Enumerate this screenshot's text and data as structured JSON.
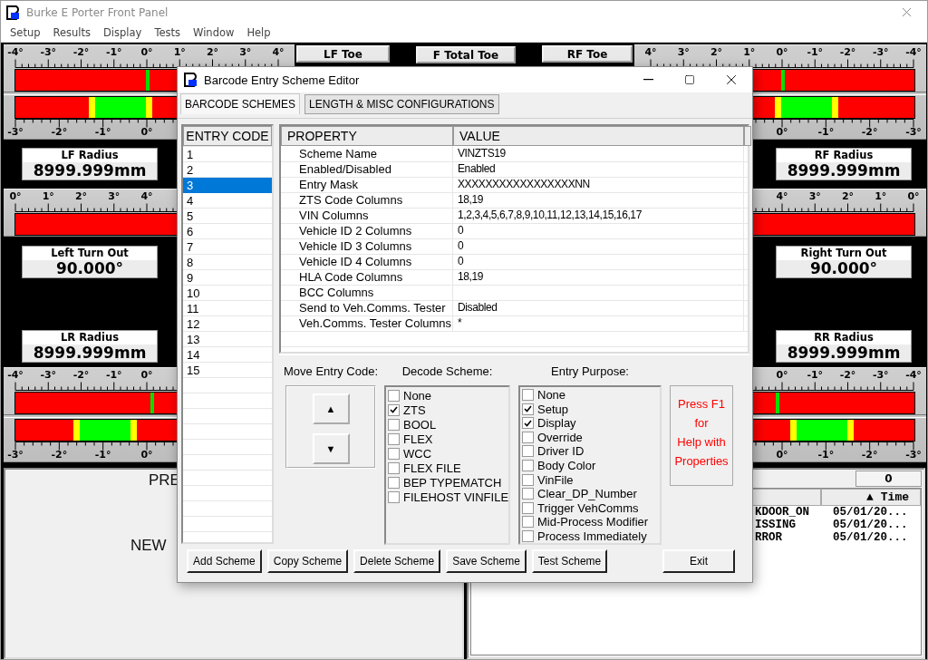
{
  "main_window": {
    "title": "Burke E Porter Front Panel"
  },
  "menu": [
    "Setup",
    "Results",
    "Display",
    "Tests",
    "Window",
    "Help"
  ],
  "front_gauges": {
    "left": {
      "label": "LF Toe",
      "top_scale": [
        "-4°",
        "-3°",
        "-2°",
        "-1°",
        "0°",
        "1°",
        "2°",
        "3°",
        "4°"
      ],
      "bars": [
        {
          "kind": "marker",
          "level": 0.5
        },
        {
          "kind": "band",
          "level": 0.4
        }
      ],
      "bottom_scale": [
        "-3°",
        "-2°",
        "-1°",
        "0°"
      ]
    },
    "center_label": "F Total Toe",
    "right": {
      "label": "RF Toe",
      "top_scale": [
        "4°",
        "3°",
        "2°",
        "1°",
        "0°",
        "-1°",
        "-2°",
        "-3°",
        "-4°"
      ],
      "bars": [
        {
          "kind": "marker",
          "level": 0.5
        },
        {
          "kind": "band",
          "level": 0.59
        }
      ],
      "bottom_scale": [
        "0°",
        "-1°",
        "-2°",
        "-3°"
      ]
    }
  },
  "radius_boxes": {
    "left": [
      {
        "label": "LF Radius",
        "value": "8999.999mm"
      }
    ],
    "right": [
      {
        "label": "RF Radius",
        "value": "8999.999mm"
      }
    ]
  },
  "mid_gauges": {
    "left": {
      "top_scale": [
        "0°",
        "1°",
        "2°",
        "3°",
        "4°"
      ],
      "bars": [
        {
          "kind": "plain"
        }
      ]
    },
    "right": {
      "top_scale": [
        "4°",
        "3°",
        "2°",
        "1°",
        "0°"
      ],
      "bars": [
        {
          "kind": "plain"
        }
      ]
    }
  },
  "turn_boxes": {
    "left": [
      {
        "label": "Left Turn Out",
        "value": "90.000°"
      },
      {
        "label": "LR Radius",
        "value": "8999.999mm"
      }
    ],
    "right": [
      {
        "label": "Right Turn Out",
        "value": "90.000°"
      },
      {
        "label": "RR Radius",
        "value": "8999.999mm"
      }
    ]
  },
  "rear_gauges": {
    "left": {
      "top_scale": [
        "-4°",
        "-3°",
        "-2°",
        "-1°",
        "0°"
      ],
      "bars": [
        {
          "kind": "marker",
          "level": 0.52
        },
        {
          "kind": "band",
          "level": 0.34
        }
      ],
      "bottom_scale": [
        "-3°",
        "-2°",
        "-1°",
        "0°"
      ]
    },
    "right": {
      "top_scale": [
        "0°",
        "-1°",
        "-2°",
        "-3°",
        "-4°"
      ],
      "bars": [
        {
          "kind": "marker",
          "level": 0.48
        },
        {
          "kind": "band",
          "level": 0.65
        }
      ],
      "bottom_scale": [
        "0°",
        "-1°",
        "-2°",
        "-3°"
      ]
    }
  },
  "prompt_panel": {
    "lines": [
      "PRE",
      "NEW"
    ]
  },
  "event_panel": {
    "counter": "0",
    "sort_glyph": "▲",
    "time_column": "Time",
    "rows": [
      {
        "event": "KDOOR_ON",
        "time": "05/01/20..."
      },
      {
        "event": "ISSING",
        "time": "05/01/20..."
      },
      {
        "event": "RROR",
        "time": "05/01/20..."
      }
    ]
  },
  "dialog": {
    "title": "Barcode Entry Scheme Editor",
    "tabs": [
      {
        "label": "BARCODE SCHEMES",
        "selected": true
      },
      {
        "label": "LENGTH & MISC CONFIGURATIONS",
        "selected": false
      }
    ],
    "entry_code_header": "ENTRY CODE",
    "entry_codes": [
      {
        "label": "1",
        "selected": false
      },
      {
        "label": "2",
        "selected": false
      },
      {
        "label": "3",
        "selected": true
      },
      {
        "label": "4",
        "selected": false
      },
      {
        "label": "5",
        "selected": false
      },
      {
        "label": "6",
        "selected": false
      },
      {
        "label": "7",
        "selected": false
      },
      {
        "label": "8",
        "selected": false
      },
      {
        "label": "9",
        "selected": false
      },
      {
        "label": "10",
        "selected": false
      },
      {
        "label": "11",
        "selected": false
      },
      {
        "label": "12",
        "selected": false
      },
      {
        "label": "13",
        "selected": false
      },
      {
        "label": "14",
        "selected": false
      },
      {
        "label": "15",
        "selected": false
      }
    ],
    "property_columns": [
      "PROPERTY",
      "VALUE"
    ],
    "properties": [
      {
        "name": "Scheme Name",
        "value": "VINZTS19"
      },
      {
        "name": "Enabled/Disabled",
        "value": "Enabled"
      },
      {
        "name": "Entry Mask",
        "value": "XXXXXXXXXXXXXXXXXNN"
      },
      {
        "name": "ZTS Code Columns",
        "value": "18,19"
      },
      {
        "name": "VIN Columns",
        "value": "1,2,3,4,5,6,7,8,9,10,11,12,13,14,15,16,17"
      },
      {
        "name": "Vehicle ID 2 Columns",
        "value": "0"
      },
      {
        "name": "Vehicle ID 3 Columns",
        "value": "0"
      },
      {
        "name": "Vehicle ID 4 Columns",
        "value": "0"
      },
      {
        "name": "HLA Code Columns",
        "value": "18,19"
      },
      {
        "name": "BCC Columns"
      },
      {
        "name": "Send to Veh.Comms. Tester",
        "value": "Disabled"
      },
      {
        "name": "Veh.Comms. Tester Columns",
        "value": "*"
      }
    ],
    "move_label": "Move Entry Code:",
    "move_buttons": [
      "▲",
      "▼"
    ],
    "decode_label": "Decode Scheme:",
    "decode_options": [
      {
        "label": "None",
        "checked": false
      },
      {
        "label": "ZTS",
        "checked": true
      },
      {
        "label": "BOOL",
        "checked": false
      },
      {
        "label": "FLEX",
        "checked": false
      },
      {
        "label": "WCC",
        "checked": false
      },
      {
        "label": "FLEX FILE",
        "checked": false
      },
      {
        "label": "BEP TYPEMATCH",
        "checked": false
      },
      {
        "label": "FILEHOST VINFILE",
        "checked": false
      }
    ],
    "purpose_label": "Entry Purpose:",
    "purpose_options": [
      {
        "label": "None",
        "checked": false
      },
      {
        "label": "Setup",
        "checked": true
      },
      {
        "label": "Display",
        "checked": true
      },
      {
        "label": "Override",
        "checked": false
      },
      {
        "label": "Driver ID",
        "checked": false
      },
      {
        "label": "Body Color",
        "checked": false
      },
      {
        "label": "VinFile",
        "checked": false
      },
      {
        "label": "Clear_DP_Number",
        "checked": false
      },
      {
        "label": "Trigger VehComms",
        "checked": false
      },
      {
        "label": "Mid-Process Modifier",
        "checked": false
      },
      {
        "label": "Process Immediately",
        "checked": false
      }
    ],
    "help_lines": [
      "Press F1",
      "for",
      "Help with",
      "Properties"
    ],
    "buttons": [
      {
        "label": "Add Scheme",
        "kind": "action"
      },
      {
        "label": "Copy Scheme",
        "kind": "action"
      },
      {
        "label": "Delete Scheme",
        "kind": "action"
      },
      {
        "label": "Save Scheme",
        "kind": "action"
      },
      {
        "label": "Test Scheme",
        "kind": "action"
      },
      {
        "label": "Exit",
        "kind": "exit"
      }
    ]
  }
}
